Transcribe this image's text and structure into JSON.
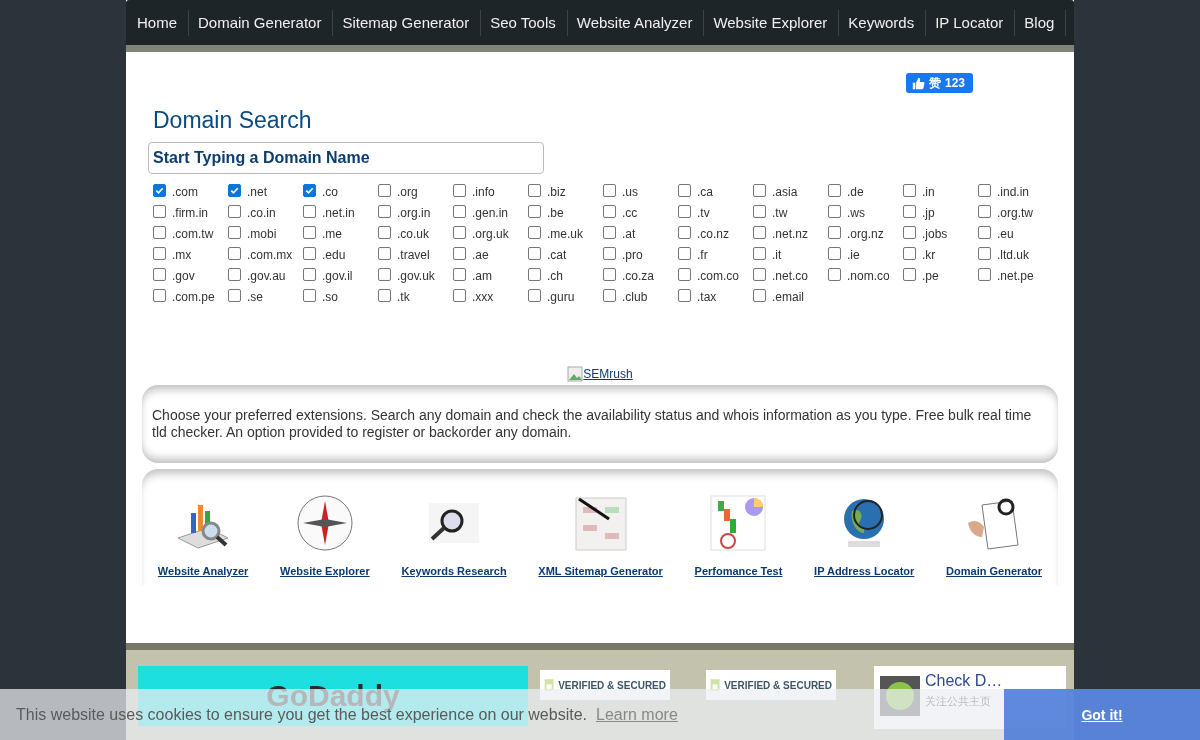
{
  "nav": [
    {
      "label": "Home"
    },
    {
      "label": "Domain Generator"
    },
    {
      "label": "Sitemap Generator"
    },
    {
      "label": "Seo Tools"
    },
    {
      "label": "Website Analyzer"
    },
    {
      "label": "Website Explorer"
    },
    {
      "label": "Keywords"
    },
    {
      "label": "IP Locator"
    },
    {
      "label": "Blog"
    }
  ],
  "like_button": {
    "label": "赞",
    "count": "123"
  },
  "title": "Domain Search",
  "search": {
    "placeholder": "Start Typing a Domain Name"
  },
  "extensions": [
    {
      "label": ".com",
      "checked": true
    },
    {
      "label": ".net",
      "checked": true
    },
    {
      "label": ".co",
      "checked": true
    },
    {
      "label": ".org",
      "checked": false
    },
    {
      "label": ".info",
      "checked": false
    },
    {
      "label": ".biz",
      "checked": false
    },
    {
      "label": ".us",
      "checked": false
    },
    {
      "label": ".ca",
      "checked": false
    },
    {
      "label": ".asia",
      "checked": false
    },
    {
      "label": ".de",
      "checked": false
    },
    {
      "label": ".in",
      "checked": false
    },
    {
      "label": ".ind.in",
      "checked": false
    },
    {
      "label": ".firm.in",
      "checked": false
    },
    {
      "label": ".co.in",
      "checked": false
    },
    {
      "label": ".net.in",
      "checked": false
    },
    {
      "label": ".org.in",
      "checked": false
    },
    {
      "label": ".gen.in",
      "checked": false
    },
    {
      "label": ".be",
      "checked": false
    },
    {
      "label": ".cc",
      "checked": false
    },
    {
      "label": ".tv",
      "checked": false
    },
    {
      "label": ".tw",
      "checked": false
    },
    {
      "label": ".ws",
      "checked": false
    },
    {
      "label": ".jp",
      "checked": false
    },
    {
      "label": ".org.tw",
      "checked": false
    },
    {
      "label": ".com.tw",
      "checked": false
    },
    {
      "label": ".mobi",
      "checked": false
    },
    {
      "label": ".me",
      "checked": false
    },
    {
      "label": ".co.uk",
      "checked": false
    },
    {
      "label": ".org.uk",
      "checked": false
    },
    {
      "label": ".me.uk",
      "checked": false
    },
    {
      "label": ".at",
      "checked": false
    },
    {
      "label": ".co.nz",
      "checked": false
    },
    {
      "label": ".net.nz",
      "checked": false
    },
    {
      "label": ".org.nz",
      "checked": false
    },
    {
      "label": ".jobs",
      "checked": false
    },
    {
      "label": ".eu",
      "checked": false
    },
    {
      "label": ".mx",
      "checked": false
    },
    {
      "label": ".com.mx",
      "checked": false
    },
    {
      "label": ".edu",
      "checked": false
    },
    {
      "label": ".travel",
      "checked": false
    },
    {
      "label": ".ae",
      "checked": false
    },
    {
      "label": ".cat",
      "checked": false
    },
    {
      "label": ".pro",
      "checked": false
    },
    {
      "label": ".fr",
      "checked": false
    },
    {
      "label": ".it",
      "checked": false
    },
    {
      "label": ".ie",
      "checked": false
    },
    {
      "label": ".kr",
      "checked": false
    },
    {
      "label": ".ltd.uk",
      "checked": false
    },
    {
      "label": ".gov",
      "checked": false
    },
    {
      "label": ".gov.au",
      "checked": false
    },
    {
      "label": ".gov.il",
      "checked": false
    },
    {
      "label": ".gov.uk",
      "checked": false
    },
    {
      "label": ".am",
      "checked": false
    },
    {
      "label": ".ch",
      "checked": false
    },
    {
      "label": ".co.za",
      "checked": false
    },
    {
      "label": ".com.co",
      "checked": false
    },
    {
      "label": ".net.co",
      "checked": false
    },
    {
      "label": ".nom.co",
      "checked": false
    },
    {
      "label": ".pe",
      "checked": false
    },
    {
      "label": ".net.pe",
      "checked": false
    },
    {
      "label": ".com.pe",
      "checked": false
    },
    {
      "label": ".se",
      "checked": false
    },
    {
      "label": ".so",
      "checked": false
    },
    {
      "label": ".tk",
      "checked": false
    },
    {
      "label": ".xxx",
      "checked": false
    },
    {
      "label": ".guru",
      "checked": false
    },
    {
      "label": ".club",
      "checked": false
    },
    {
      "label": ".tax",
      "checked": false
    },
    {
      "label": ".email",
      "checked": false
    }
  ],
  "ad_link": "SEMrush",
  "description": "Choose your preferred extensions. Search any domain and check the availability status and whois information as you type. Free bulk real time tld checker. An option provided to register or backorder any domain.",
  "tools": [
    {
      "label": "Website Analyzer"
    },
    {
      "label": "Website Explorer"
    },
    {
      "label": "Keywords Research"
    },
    {
      "label": "XML Sitemap Generator"
    },
    {
      "label": "Perfomance Test"
    },
    {
      "label": "IP Address Locator"
    },
    {
      "label": "Domain Generator"
    }
  ],
  "footer": {
    "banner": "GoDaddy",
    "badges": [
      "VERIFIED & SECURED",
      "VERIFIED & SECURED"
    ],
    "page_card": {
      "name": "Check D…",
      "follow": "关注公共主页"
    }
  },
  "cookie_bar": {
    "message": "This website uses cookies to ensure you get the best experience on our website.",
    "link": "Learn more",
    "button": "Got it!"
  }
}
